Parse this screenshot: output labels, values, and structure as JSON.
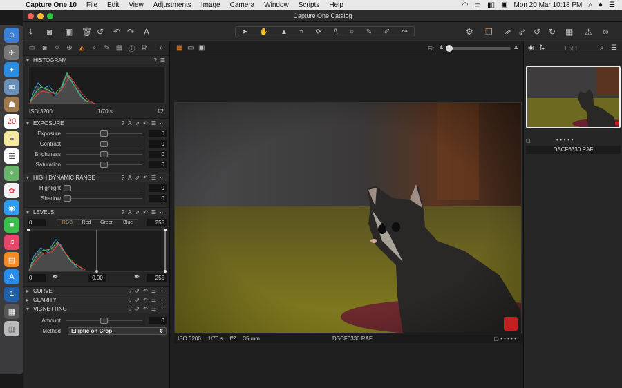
{
  "menubar": {
    "app": "Capture One 10",
    "items": [
      "File",
      "Edit",
      "View",
      "Adjustments",
      "Image",
      "Camera",
      "Window",
      "Scripts",
      "Help"
    ],
    "clock": "Mon 20 Mar  10:18 PM"
  },
  "window": {
    "title": "Capture One Catalog"
  },
  "histogram": {
    "title": "HISTOGRAM",
    "iso": "ISO 3200",
    "shutter": "1/70 s",
    "aperture": "f/2"
  },
  "exposure": {
    "title": "EXPOSURE",
    "rows": [
      {
        "label": "Exposure",
        "value": "0"
      },
      {
        "label": "Contrast",
        "value": "0"
      },
      {
        "label": "Brightness",
        "value": "0"
      },
      {
        "label": "Saturation",
        "value": "0"
      }
    ]
  },
  "hdr": {
    "title": "HIGH DYNAMIC RANGE",
    "rows": [
      {
        "label": "Highlight",
        "value": "0"
      },
      {
        "label": "Shadow",
        "value": "0"
      }
    ]
  },
  "levels": {
    "title": "LEVELS",
    "in_low": "0",
    "in_high": "255",
    "channels": [
      "RGB",
      "Red",
      "Green",
      "Blue"
    ],
    "out_low": "0",
    "mid": "0.00",
    "out_high": "255"
  },
  "collapsed": [
    "CURVE",
    "CLARITY"
  ],
  "vignetting": {
    "title": "VIGNETTING",
    "amount_label": "Amount",
    "amount": "0",
    "method_label": "Method",
    "method": "Elliptic on Crop"
  },
  "viewer": {
    "fit": "Fit",
    "iso": "ISO 3200",
    "shutter": "1/70 s",
    "aperture": "f/2",
    "focal": "35 mm",
    "filename": "DSCF6330.RAF"
  },
  "browser": {
    "count": "1 of 1",
    "filename": "DSCF6330.RAF"
  }
}
